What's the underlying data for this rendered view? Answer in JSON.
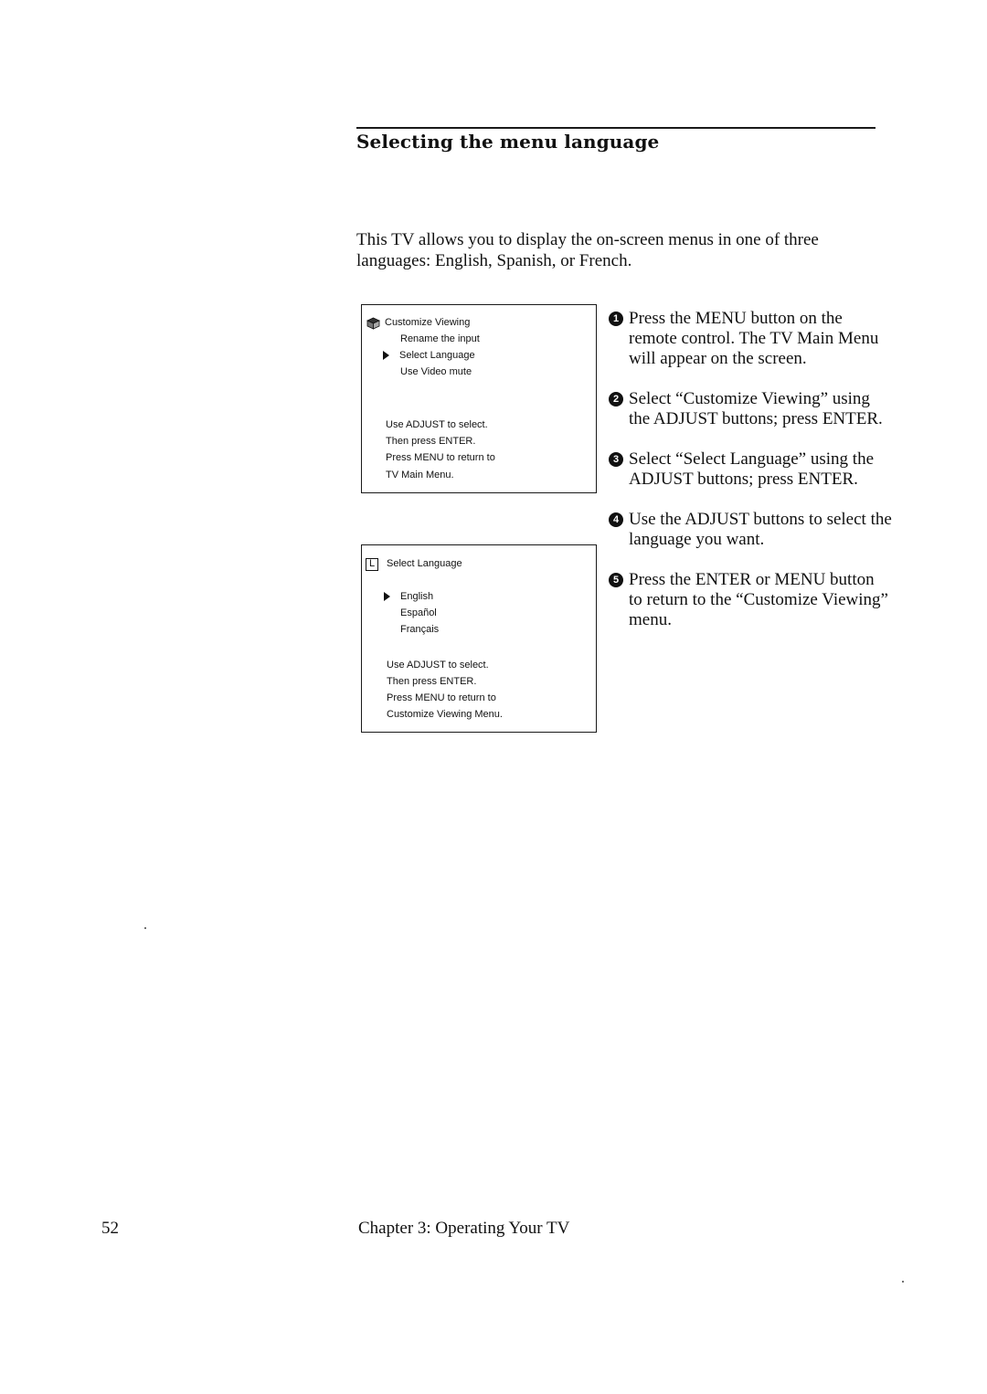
{
  "section": {
    "title": "Selecting the menu language",
    "intro": "This TV allows you to display the on-screen menus in one of three languages: English, Spanish, or French."
  },
  "screen1": {
    "icon": "customize-cube-icon",
    "title": "Customize Viewing",
    "items": [
      "Rename the input",
      "Select Language",
      "Use Video mute"
    ],
    "selected_index": 1,
    "instructions": [
      "Use ADJUST to select.",
      "Then press ENTER.",
      "Press MENU to return to",
      "TV Main Menu."
    ]
  },
  "screen2": {
    "icon": "language-L-icon",
    "icon_glyph": "L",
    "title": "Select Language",
    "items": [
      "English",
      "Español",
      "Français"
    ],
    "selected_index": 0,
    "instructions": [
      "Use ADJUST to select.",
      "Then press ENTER.",
      "Press MENU to return to",
      "Customize Viewing Menu."
    ]
  },
  "steps": [
    {
      "num": "1",
      "text": "Press the MENU button on the remote control. The TV Main Menu will appear on the screen."
    },
    {
      "num": "2",
      "text": "Select “Customize Viewing” using the ADJUST buttons; press ENTER."
    },
    {
      "num": "3",
      "text": "Select “Select Language” using the ADJUST buttons; press ENTER."
    },
    {
      "num": "4",
      "text": "Use the ADJUST buttons to select the language you want."
    },
    {
      "num": "5",
      "text": "Press the ENTER or MENU button to return to the “Customize Viewing” menu."
    }
  ],
  "footer": {
    "page_number": "52",
    "chapter": "Chapter 3: Operating Your TV"
  }
}
